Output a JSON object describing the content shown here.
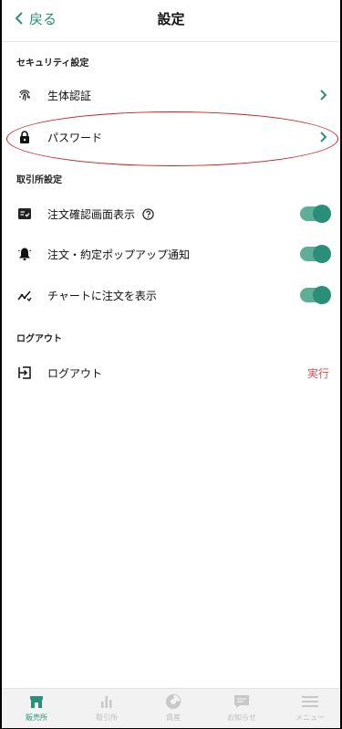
{
  "header": {
    "back_label": "戻る",
    "title": "設定"
  },
  "sections": {
    "security": {
      "title": "セキュリティ設定",
      "items": [
        {
          "label": "生体認証",
          "icon": "fingerprint-icon"
        },
        {
          "label": "パスワード",
          "icon": "lock-icon"
        }
      ]
    },
    "exchange": {
      "title": "取引所設定",
      "items": [
        {
          "label": "注文確認画面表示",
          "icon": "order-confirm-icon",
          "help_icon": "help-circle-icon",
          "enabled": true
        },
        {
          "label": "注文・約定ポップアップ通知",
          "icon": "bell-icon",
          "enabled": true
        },
        {
          "label": "チャートに注文を表示",
          "icon": "chart-order-icon",
          "enabled": true
        }
      ]
    },
    "logout": {
      "title": "ログアウト",
      "item": {
        "label": "ログアウト",
        "icon": "logout-icon",
        "action": "実行"
      }
    }
  },
  "tabbar": {
    "tabs": [
      {
        "label": "販売所",
        "icon": "store-icon",
        "active": true
      },
      {
        "label": "取引所",
        "icon": "bar-chart-icon",
        "active": false
      },
      {
        "label": "資産",
        "icon": "pie-chart-icon",
        "active": false
      },
      {
        "label": "お知らせ",
        "icon": "message-icon",
        "active": false
      },
      {
        "label": "メニュー",
        "icon": "menu-icon",
        "active": false
      }
    ]
  },
  "colors": {
    "accent": "#2a8f78",
    "toggle_track": "#5fae97",
    "danger": "#e34c4c",
    "annotation": "#d21f1f"
  }
}
